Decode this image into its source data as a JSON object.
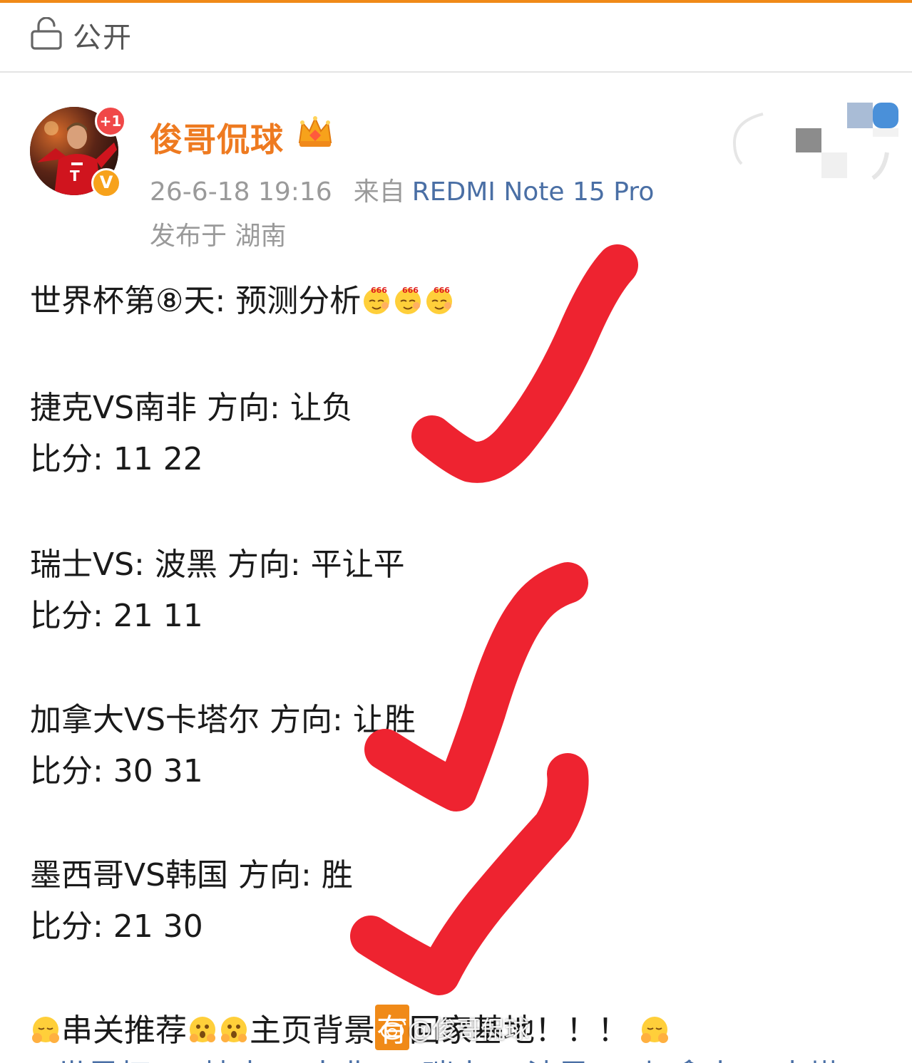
{
  "visibility": {
    "label": "公开",
    "icon": "lock-open-icon"
  },
  "post": {
    "author": {
      "name": "俊哥侃球",
      "badge_count": "+1",
      "verified_mark": "V",
      "crown_icon": "crown-icon"
    },
    "meta": {
      "time": "26-6-18 19:16",
      "source_prefix": "来自",
      "device": "REDMI Note 15 Pro",
      "location": "发布于 湖南"
    },
    "title": "世界杯第⑧天: 预测分析",
    "matches": [
      {
        "teams": "捷克VS南非  方向: 让负",
        "score": "比分: 11 22"
      },
      {
        "teams": "瑞士VS:  波黑 方向: 平让平",
        "score": "比分: 21 11"
      },
      {
        "teams": "加拿大VS卡塔尔 方向: 让胜",
        "score": "比分: 30 31"
      },
      {
        "teams": "墨西哥VS韩国 方向: 胜",
        "score": "比分:  21 30"
      }
    ],
    "footer": {
      "part1": "串关推荐",
      "part2": "主页背景",
      "part3": "有",
      "part4": "回家基地！！！",
      "hashtags": "#世界杯##捷克VS南非##瑞士VS波黑##加拿大VS卡塔"
    }
  },
  "watermark": "@俊哥侃球",
  "colors": {
    "accent": "#f08a18",
    "username": "#ee7a20",
    "device": "#4a6fa5",
    "check": "#ee2330"
  }
}
